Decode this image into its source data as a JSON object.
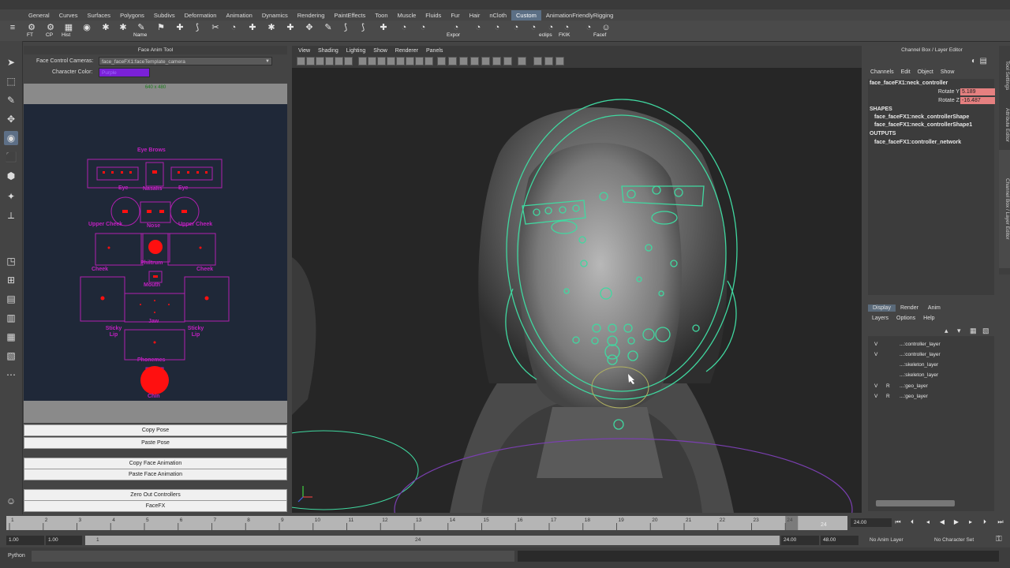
{
  "shelf": {
    "tabs": [
      "General",
      "Curves",
      "Surfaces",
      "Polygons",
      "Subdivs",
      "Deformation",
      "Animation",
      "Dynamics",
      "Rendering",
      "PaintEffects",
      "Toon",
      "Muscle",
      "Fluids",
      "Fur",
      "Hair",
      "nCloth",
      "Custom",
      "AnimationFriendlyRigging"
    ],
    "active_tab": "Custom",
    "icon_labels": {
      "ft": "FT",
      "cp": "CP",
      "hist": "Hist",
      "name": "Name",
      "expor": "Expor",
      "eclips": "eclips",
      "fkik": "FKIK",
      "facef": "Facef"
    }
  },
  "face_anim_tool": {
    "title": "Face Anim Tool",
    "cameras_label": "Face Control Cameras:",
    "camera_value": "face_faceFX1:faceTemplate_camera",
    "color_label": "Character Color:",
    "color_value": "Purple",
    "canvas_size": "640 x 480",
    "regions": {
      "eye_brows": "Eye Brows",
      "eye_left": "Eye",
      "nasalis": "Nasalis",
      "eye_right": "Eye",
      "upper_cheek_left": "Upper Cheek",
      "nose": "Nose",
      "upper_cheek_right": "Upper Cheek",
      "philtrum": "Philtrum",
      "cheek_left": "Cheek",
      "mouth": "Mouth",
      "cheek_right": "Cheek",
      "sticky_lip_left": "Sticky Lip",
      "jaw": "Jaw",
      "sticky_lip_right": "Sticky Lip",
      "phonemes": "Phonemes",
      "chin": "Chin"
    },
    "buttons": {
      "copy_pose": "Copy Pose",
      "paste_pose": "Paste Pose",
      "copy_face_anim": "Copy Face Animation",
      "paste_face_anim": "Paste Face Animation",
      "zero_out": "Zero Out Controllers",
      "facefx": "FaceFX"
    },
    "accent": "#c020c0",
    "control_red": "#ff1010"
  },
  "viewport": {
    "menus": [
      "View",
      "Shading",
      "Lighting",
      "Show",
      "Renderer",
      "Panels"
    ],
    "rig_color": "#40d8a0"
  },
  "channel_box": {
    "title": "Channel Box / Layer Editor",
    "menus": [
      "Channels",
      "Edit",
      "Object",
      "Show"
    ],
    "node": "face_faceFX1:neck_controller",
    "attrs": [
      {
        "name": "Rotate Y",
        "value": "5.189"
      },
      {
        "name": "Rotate Z",
        "value": "-16.487"
      }
    ],
    "shapes_header": "SHAPES",
    "shapes": [
      "face_faceFX1:neck_controllerShape",
      "face_faceFX1:neck_controllerShape1"
    ],
    "outputs_header": "OUTPUTS",
    "outputs": [
      "face_faceFX1:controller_network"
    ]
  },
  "side_tabs": [
    "Tool Settings",
    "Attribute Editor",
    "Channel Box / Layer Editor"
  ],
  "layer_editor": {
    "tabs": [
      "Display",
      "Render",
      "Anim"
    ],
    "active_tab": "Display",
    "menus": [
      "Layers",
      "Options",
      "Help"
    ],
    "layers": [
      {
        "v": "V",
        "r": "",
        "name": "...:controller_layer"
      },
      {
        "v": "V",
        "r": "",
        "name": "...:controller_layer"
      },
      {
        "v": "",
        "r": "",
        "name": "...:skeleton_layer"
      },
      {
        "v": "",
        "r": "",
        "name": "...:skeleton_layer"
      },
      {
        "v": "V",
        "r": "R",
        "name": "...:geo_layer"
      },
      {
        "v": "V",
        "r": "R",
        "name": "...:geo_layer"
      }
    ]
  },
  "timeline": {
    "ticks": [
      "1",
      "2",
      "3",
      "4",
      "5",
      "6",
      "7",
      "8",
      "9",
      "10",
      "11",
      "12",
      "13",
      "14",
      "15",
      "16",
      "17",
      "18",
      "19",
      "20",
      "21",
      "22",
      "23",
      "24"
    ],
    "current_frame": "24",
    "frame_field": "24.00"
  },
  "range": {
    "start_a": "1.00",
    "start_b": "1.00",
    "bar_start": "1",
    "bar_end": "24",
    "end_a": "24.00",
    "end_b": "48.00",
    "anim_layer": "No Anim Layer",
    "character_set": "No Character Set"
  },
  "command": {
    "lang": "Python"
  }
}
